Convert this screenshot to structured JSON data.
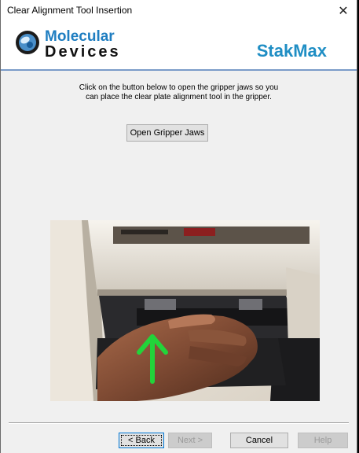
{
  "window": {
    "title": "Clear Alignment Tool Insertion",
    "close_glyph": "✕"
  },
  "header": {
    "logo_line1": "Molecular",
    "logo_line2": "Devices",
    "product": "StakMax",
    "brand_color": "#1f7ec1"
  },
  "main": {
    "instruction_line1": "Click on the button below to open the gripper jaws so you",
    "instruction_line2": "can place the clear plate alignment tool in the gripper.",
    "open_jaws_label": "Open Gripper Jaws",
    "photo_icon": "gripper-photo",
    "arrow_color": "#22d43a"
  },
  "footer": {
    "back_label": "< Back",
    "next_label": "Next >",
    "cancel_label": "Cancel",
    "help_label": "Help"
  }
}
